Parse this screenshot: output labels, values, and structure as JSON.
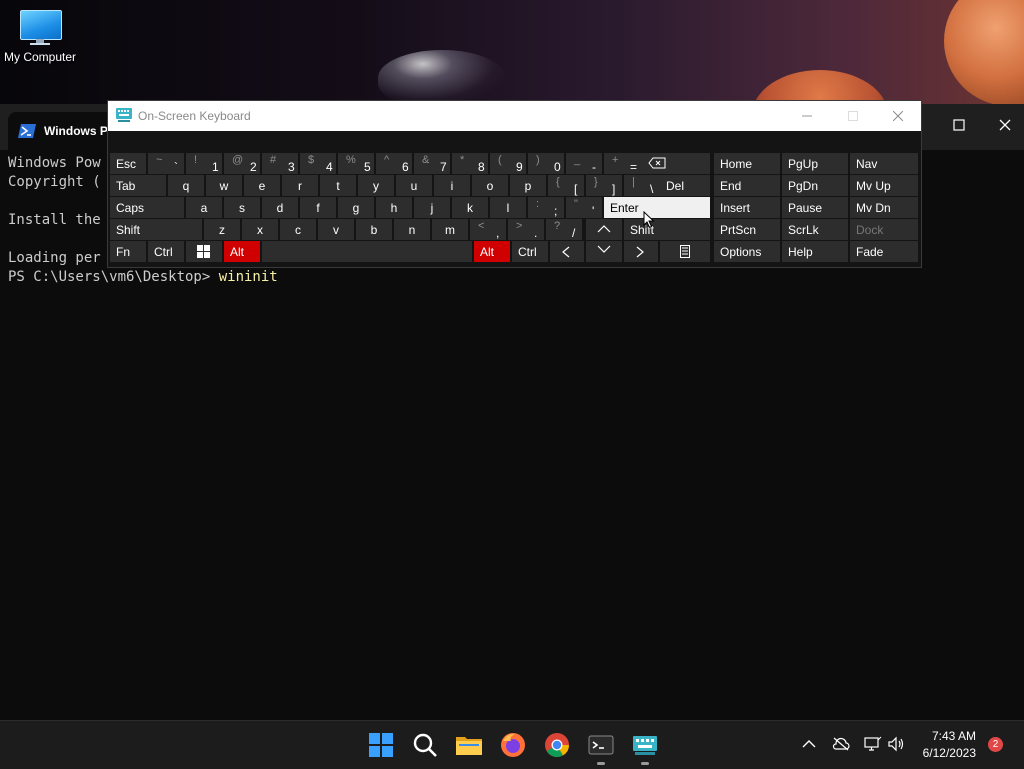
{
  "desktop": {
    "icon_label": "My Computer"
  },
  "powershell": {
    "tab_title": "Windows Po",
    "lines": [
      "Windows Pow",
      "Copyright (",
      "",
      "Install the",
      "",
      "Loading per"
    ],
    "prompt": "PS C:\\Users\\vm6\\Desktop> ",
    "command": "wininit"
  },
  "osk": {
    "title": "On-Screen Keyboard",
    "row1": {
      "esc": "Esc",
      "keys": [
        {
          "shift": "~",
          "main": "`"
        },
        {
          "shift": "!",
          "main": "1"
        },
        {
          "shift": "@",
          "main": "2"
        },
        {
          "shift": "#",
          "main": "3"
        },
        {
          "shift": "$",
          "main": "4"
        },
        {
          "shift": "%",
          "main": "5"
        },
        {
          "shift": "^",
          "main": "6"
        },
        {
          "shift": "&",
          "main": "7"
        },
        {
          "shift": "*",
          "main": "8"
        },
        {
          "shift": "(",
          "main": "9"
        },
        {
          "shift": ")",
          "main": "0"
        },
        {
          "shift": "_",
          "main": "-"
        },
        {
          "shift": "+",
          "main": "="
        }
      ],
      "backspace_glyph": "⌫"
    },
    "row2": {
      "tab": "Tab",
      "keys": [
        "q",
        "w",
        "e",
        "r",
        "t",
        "y",
        "u",
        "i",
        "o",
        "p"
      ],
      "brackets": [
        {
          "shift": "{",
          "main": "["
        },
        {
          "shift": "}",
          "main": "]"
        },
        {
          "shift": "|",
          "main": "\\"
        }
      ],
      "del": "Del"
    },
    "row3": {
      "caps": "Caps",
      "keys": [
        "a",
        "s",
        "d",
        "f",
        "g",
        "h",
        "j",
        "k",
        "l"
      ],
      "punct": [
        {
          "shift": ":",
          "main": ";"
        },
        {
          "shift": "\"",
          "main": "'"
        }
      ],
      "enter": "Enter"
    },
    "row4": {
      "shift_left": "Shift",
      "keys": [
        "z",
        "x",
        "c",
        "v",
        "b",
        "n",
        "m"
      ],
      "punct": [
        {
          "shift": "<",
          "main": ","
        },
        {
          "shift": ">",
          "main": "."
        },
        {
          "shift": "?",
          "main": "/"
        }
      ],
      "up_glyph": "^",
      "shift_right": "Shift"
    },
    "row5": {
      "fn": "Fn",
      "ctrl_left": "Ctrl",
      "alt_left": "Alt",
      "alt_right": "Alt",
      "ctrl_right": "Ctrl",
      "left_glyph": "<",
      "down_glyph": "v",
      "right_glyph": ">",
      "menu_glyph": "▤"
    },
    "nav_block": {
      "home": "Home",
      "pgup": "PgUp",
      "nav": "Nav",
      "end": "End",
      "pgdn": "PgDn",
      "mvup": "Mv Up",
      "insert": "Insert",
      "pause": "Pause",
      "mvdn": "Mv Dn",
      "prtscn": "PrtScn",
      "scrlk": "ScrLk",
      "dock": "Dock",
      "options": "Options",
      "help": "Help",
      "fade": "Fade"
    },
    "colors": {
      "alt_active": "#d00000",
      "key_bg": "#2d2d2d",
      "hover_key": "#f0f0f0"
    }
  },
  "tray": {
    "time": "7:43 AM",
    "date": "6/12/2023",
    "notifications": "2"
  }
}
